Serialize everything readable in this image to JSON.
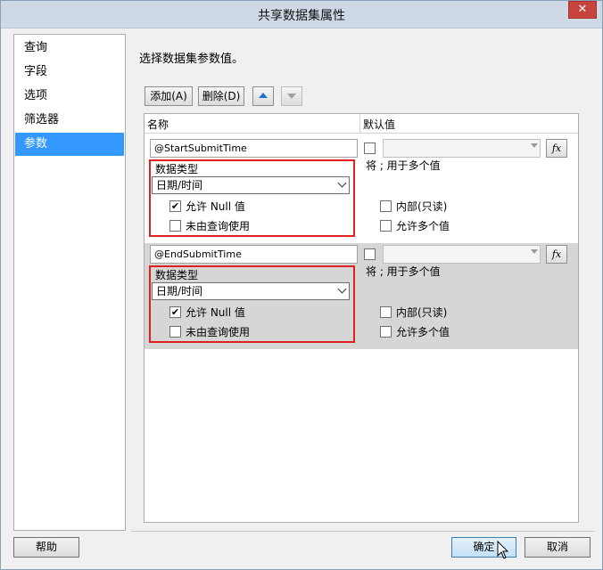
{
  "window": {
    "title": "共享数据集属性",
    "close_label": "✕"
  },
  "nav": {
    "items": [
      {
        "label": "查询"
      },
      {
        "label": "字段"
      },
      {
        "label": "选项"
      },
      {
        "label": "筛选器"
      },
      {
        "label": "参数"
      }
    ],
    "selected": "参数"
  },
  "main": {
    "prompt": "选择数据集参数值。",
    "toolbar": {
      "add_label": "添加(A)",
      "delete_label": "删除(D)"
    },
    "grid": {
      "col_name": "名称",
      "col_default": "默认值",
      "params": [
        {
          "name": "@StartSubmitTime",
          "null_text": "将 ; 用于多个值",
          "data_type_label": "数据类型",
          "data_type_value": "日期/时间",
          "allow_null_label": "允许 Null 值",
          "allow_null": true,
          "not_query_label": "未由查询使用",
          "not_query": false,
          "internal_label": "内部(只读)",
          "internal": false,
          "multi_label": "允许多个值",
          "multi": false,
          "fx_label": "fx"
        },
        {
          "name": "@EndSubmitTime",
          "null_text": "将 ; 用于多个值",
          "data_type_label": "数据类型",
          "data_type_value": "日期/时间",
          "allow_null_label": "允许 Null 值",
          "allow_null": true,
          "not_query_label": "未由查询使用",
          "not_query": false,
          "internal_label": "内部(只读)",
          "internal": false,
          "multi_label": "允许多个值",
          "multi": false,
          "fx_label": "fx"
        }
      ]
    }
  },
  "footer": {
    "help_label": "帮助",
    "ok_label": "确定",
    "cancel_label": "取消"
  },
  "colors": {
    "selected_nav": "#3399ff",
    "highlight": "#e02020",
    "alt_row": "#d6d6d6"
  }
}
